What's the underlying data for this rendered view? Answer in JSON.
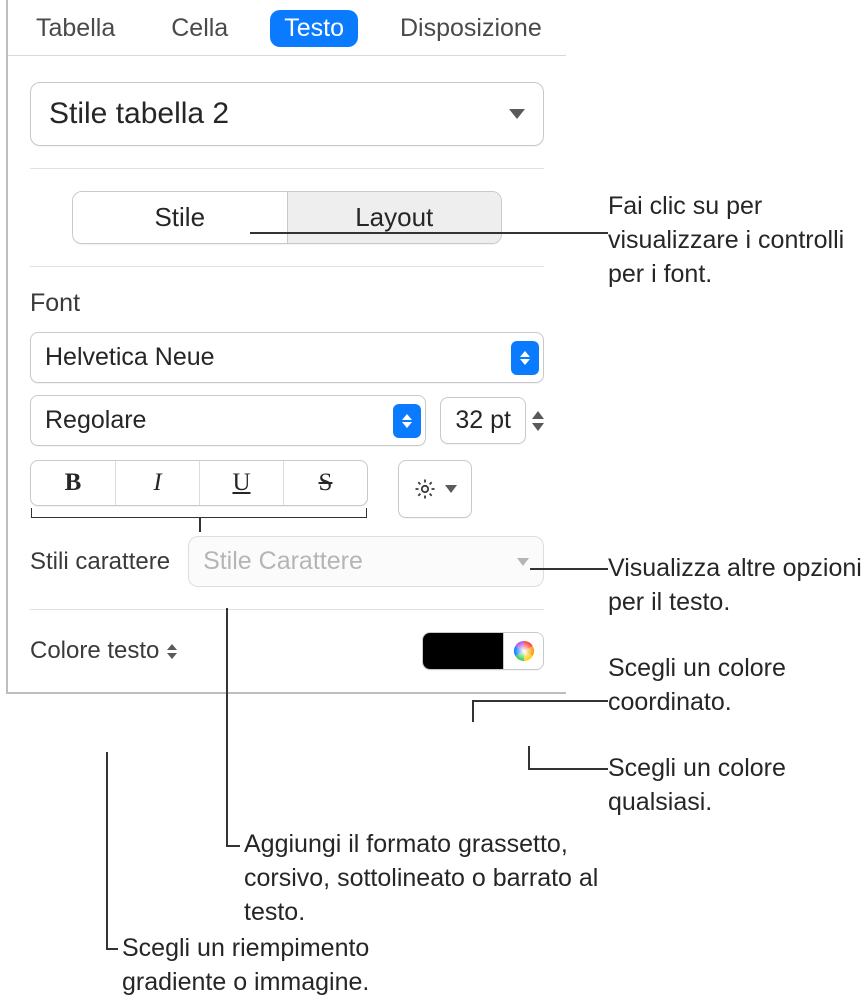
{
  "tabs": {
    "tabella": "Tabella",
    "cella": "Cella",
    "testo": "Testo",
    "disposizione": "Disposizione"
  },
  "style_select": {
    "value": "Stile tabella 2"
  },
  "segmented": {
    "stile": "Stile",
    "layout": "Layout"
  },
  "font": {
    "section_label": "Font",
    "family": "Helvetica Neue",
    "weight": "Regolare",
    "size": "32 pt",
    "bold": "B",
    "italic": "I",
    "underline": "U",
    "strike": "S"
  },
  "character_styles": {
    "label": "Stili carattere",
    "placeholder": "Stile Carattere"
  },
  "text_color": {
    "label": "Colore testo",
    "swatch": "#000000"
  },
  "callouts": {
    "stile": "Fai clic su per visualizzare i controlli per i font.",
    "gear": "Visualizza altre opzioni per il testo.",
    "well": "Scegli un colore coordinato.",
    "wheel": "Scegli un colore qualsiasi.",
    "bius": "Aggiungi il formato grassetto, corsivo, sottolineato o barrato al testo.",
    "fill": "Scegli un riempimento gradiente o immagine."
  }
}
